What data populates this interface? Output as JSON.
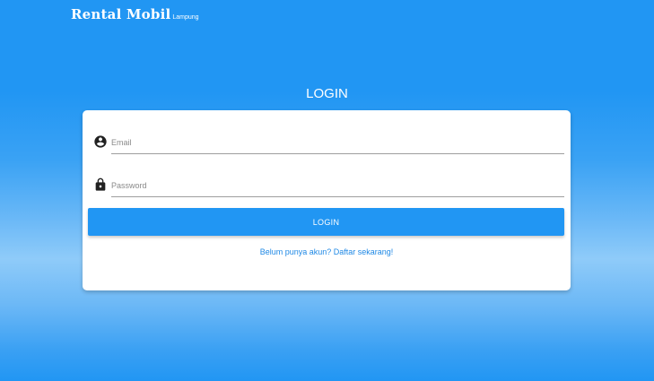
{
  "brand": {
    "name": "Rental Mobil",
    "sub": "Lampung"
  },
  "page": {
    "title": "LOGIN"
  },
  "form": {
    "email": {
      "icon": "account-circle-icon",
      "placeholder": "Email",
      "value": ""
    },
    "password": {
      "icon": "lock-icon",
      "placeholder": "Password",
      "value": ""
    },
    "login_button": "LOGIN",
    "register_link": "Belum punya akun? Daftar sekarang!"
  },
  "colors": {
    "primary": "#2196f3",
    "link": "#1e88e5",
    "card": "#ffffff"
  }
}
